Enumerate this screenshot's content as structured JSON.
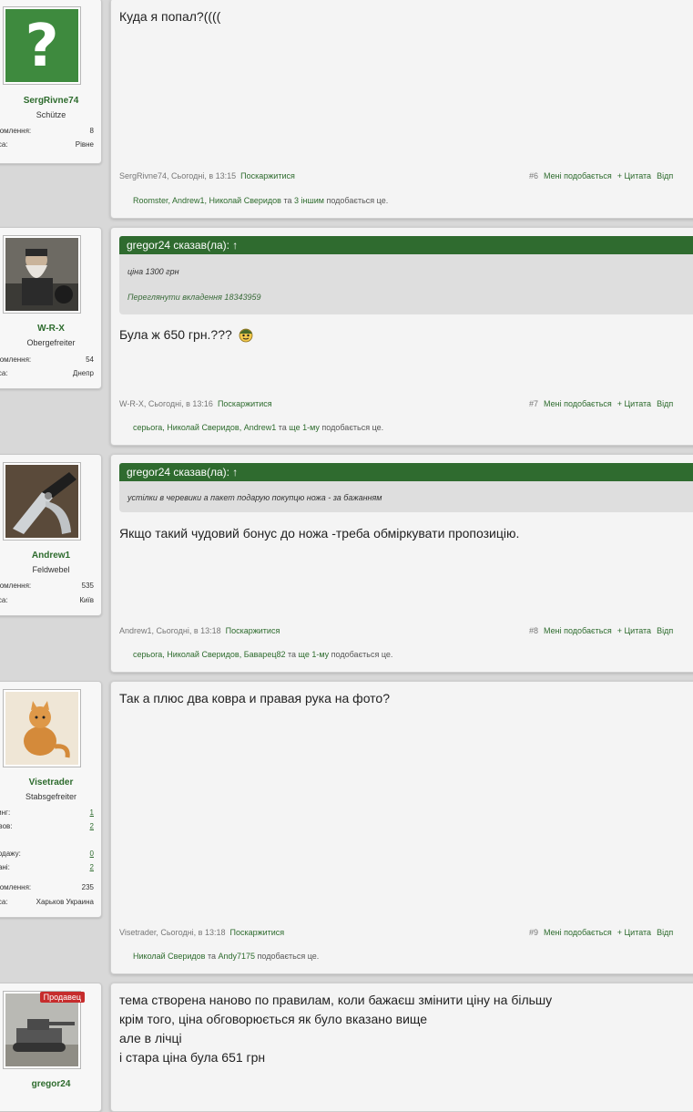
{
  "posts": [
    {
      "user": {
        "name": "SergRivne74",
        "title": "Schütze",
        "stats": [
          {
            "k": "відомлення:",
            "v": "8"
          },
          {
            "k": "реса:",
            "v": "Рівне"
          }
        ]
      },
      "text": [
        "Куда я попал?(((("
      ],
      "meta": {
        "author": "SergRivne74, Сьогодні, в 13:15",
        "report": "Поскаржитися",
        "num": "#6",
        "like": "Мені подобається",
        "quote": "+ Цитата",
        "reply": "Відп"
      },
      "likes": {
        "users": "Roomster, Andrew1, Николай Сверидов",
        "and": "та",
        "more": "3 іншим",
        "suffix": "подобається це."
      }
    },
    {
      "user": {
        "name": "W-R-X",
        "title": "Obergefreiter",
        "stats": [
          {
            "k": "відомлення:",
            "v": "54"
          },
          {
            "k": "реса:",
            "v": "Днепр"
          }
        ]
      },
      "quote": {
        "head": "gregor24 сказав(ла): ↑",
        "lines": [
          "ціна 1300 грн",
          "Переглянути вкладення 18343959"
        ]
      },
      "text": [
        "Була ж 650 грн.???"
      ],
      "meta": {
        "author": "W-R-X, Сьогодні, в 13:16",
        "report": "Поскаржитися",
        "num": "#7",
        "like": "Мені подобається",
        "quote": "+ Цитата",
        "reply": "Відп"
      },
      "likes": {
        "users": "серьога, Николай Сверидов, Andrew1",
        "and": "та",
        "more": "ще 1-му",
        "suffix": "подобається це."
      }
    },
    {
      "user": {
        "name": "Andrew1",
        "title": "Feldwebel",
        "stats": [
          {
            "k": "відомлення:",
            "v": "535"
          },
          {
            "k": "реса:",
            "v": "Київ"
          }
        ]
      },
      "quote": {
        "head": "gregor24 сказав(ла): ↑",
        "lines": [
          "устілки в черевики а пакет подарую покупцю ножа - за бажанням"
        ]
      },
      "text": [
        "Якщо такий чудовий бонус до ножа -треба обміркувати пропозицію."
      ],
      "meta": {
        "author": "Andrew1, Сьогодні, в 13:18",
        "report": "Поскаржитися",
        "num": "#8",
        "like": "Мені подобається",
        "quote": "+ Цитата",
        "reply": "Відп"
      },
      "likes": {
        "users": "серьога, Николай Сверидов, Баварец82",
        "and": "та",
        "more": "ще 1-му",
        "suffix": "подобається це."
      }
    },
    {
      "user": {
        "name": "Visetrader",
        "title": "Stabsgefreiter",
        "stats": [
          {
            "k": "йтинг:",
            "v": "1"
          },
          {
            "k": "зывов:",
            "v": "2"
          },
          {
            "k": "ти",
            "v": ""
          },
          {
            "k": "продажу:",
            "v": "0"
          },
          {
            "k": "одані:",
            "v": "2"
          },
          {
            "k": "",
            "v": ""
          },
          {
            "k": "відомлення:",
            "v": "235"
          },
          {
            "k": "реса:",
            "v": "Харьков Украина"
          }
        ]
      },
      "text": [
        "Так а плюс два ковра и правая рука на фото?"
      ],
      "meta": {
        "author": "Visetrader, Сьогодні, в 13:18",
        "report": "Поскаржитися",
        "num": "#9",
        "like": "Мені подобається",
        "quote": "+ Цитата",
        "reply": "Відп"
      },
      "likes": {
        "users": "Николай Сверидов",
        "and": "та",
        "more": "Andy7175",
        "suffix": "подобається це."
      }
    },
    {
      "user": {
        "name": "gregor24",
        "badge": "Продавец"
      },
      "text": [
        "тема створена наново по правилам, коли бажаєш змінити ціну на більшу",
        "крім того, ціна обговорюється як було вказано вище",
        "але в лічці",
        "і стара ціна була 651 грн"
      ]
    }
  ]
}
